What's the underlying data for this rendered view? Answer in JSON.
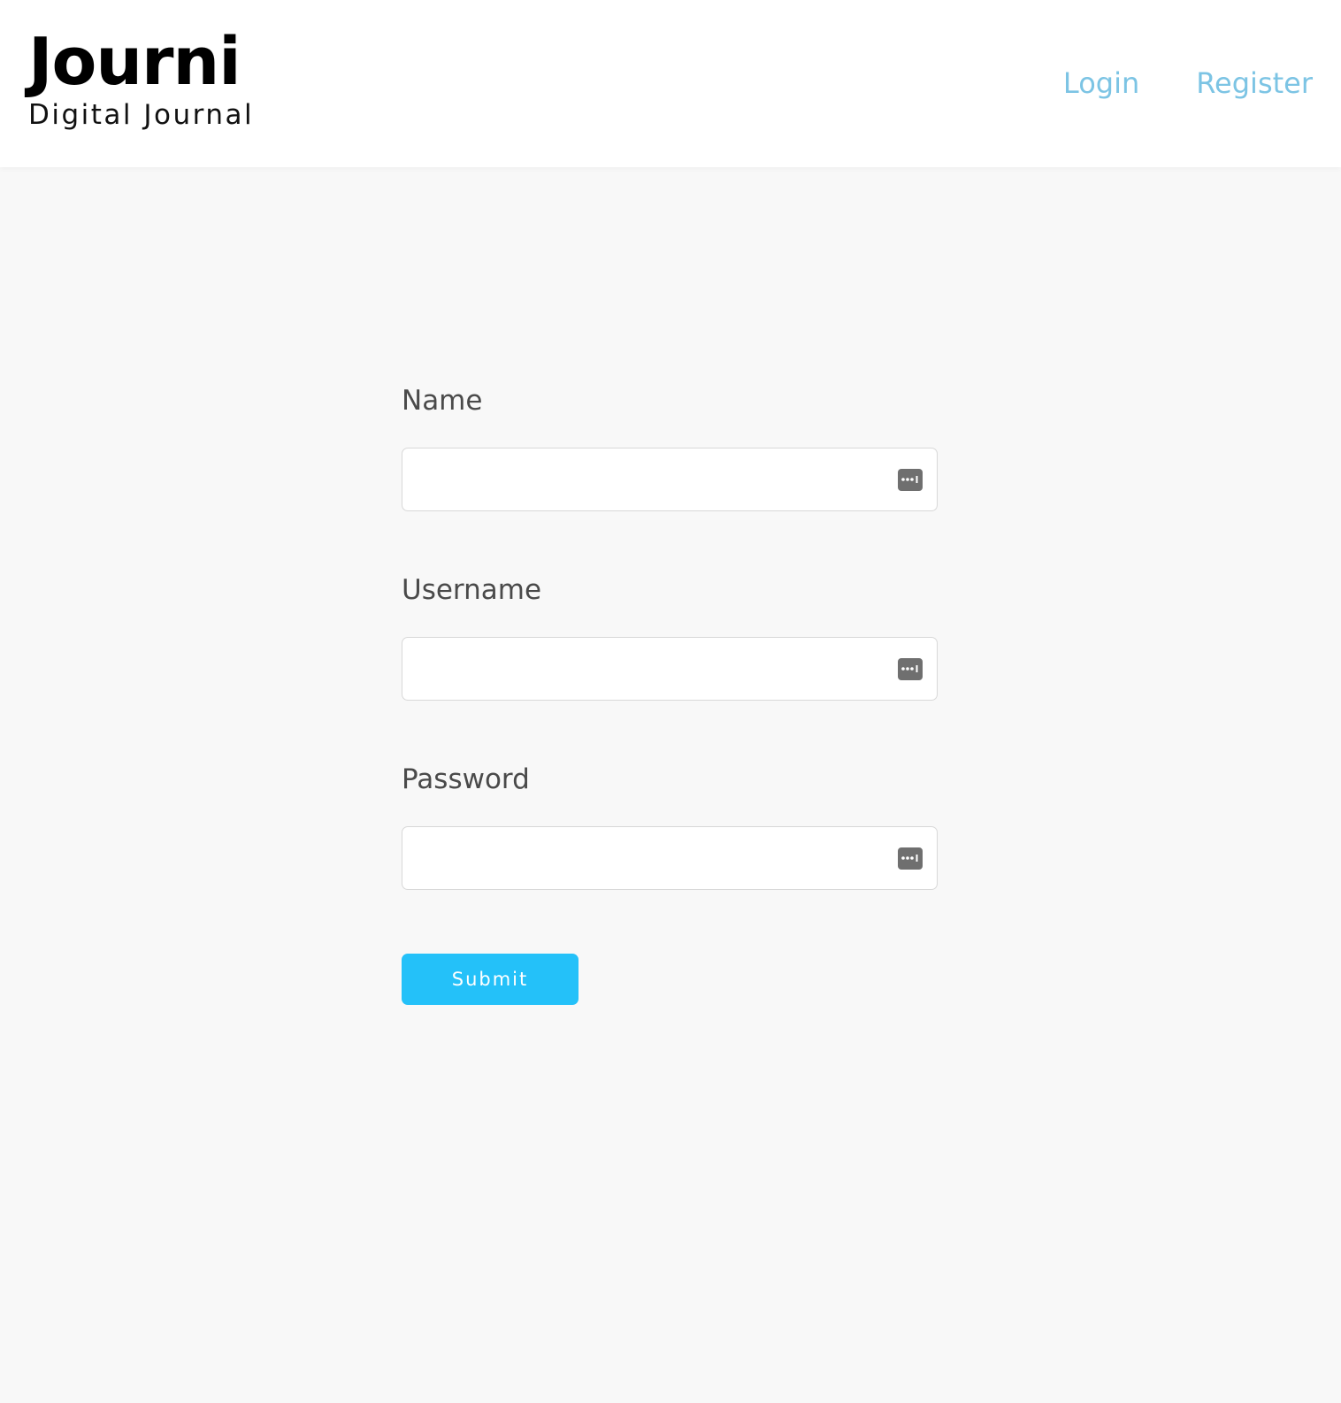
{
  "header": {
    "brand_title": "Journi",
    "brand_subtitle": "Digital Journal",
    "nav": {
      "login_label": "Login",
      "register_label": "Register"
    }
  },
  "form": {
    "fields": [
      {
        "label": "Name",
        "value": "",
        "placeholder": "",
        "icon": "password-manager-icon"
      },
      {
        "label": "Username",
        "value": "",
        "placeholder": "",
        "icon": "password-manager-icon"
      },
      {
        "label": "Password",
        "value": "",
        "placeholder": "",
        "icon": "password-manager-icon"
      }
    ],
    "submit_label": "Submit"
  },
  "colors": {
    "page_background": "#f8f8f8",
    "header_background": "#ffffff",
    "nav_link": "#7cc4e4",
    "submit_button": "#24c1f9",
    "label_text": "#4a4a4a"
  }
}
